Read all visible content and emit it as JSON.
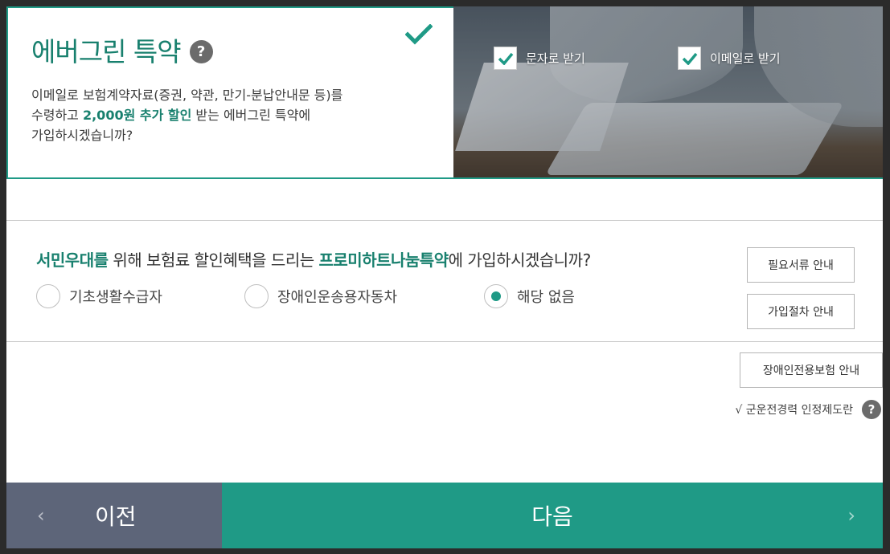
{
  "top": {
    "title": "에버그린 특약",
    "help_icon": "question-icon",
    "desc_1": "이메일로 보험계약자료(증권, 약관, 만기-분납안내문 등)를",
    "desc_2a": "수령하고 ",
    "desc_2b": "2,000원 추가 할인",
    "desc_2c": " 받는 에버그린 특약에",
    "desc_3": "가입하시겠습니까?",
    "sms_label": "문자로 받기",
    "email_label": "이메일로 받기",
    "sms_checked": true,
    "email_checked": true
  },
  "question": {
    "part1": "서민우대를",
    "part2": " 위해 보험료 할인혜택을 드리는 ",
    "part3": "프로미하트나눔특약",
    "part4": "에 가입하시겠습니까?",
    "options": [
      {
        "label": "기초생활수급자",
        "selected": false
      },
      {
        "label": "장애인운송용자동차",
        "selected": false
      },
      {
        "label": "해당 없음",
        "selected": true
      }
    ]
  },
  "buttons": {
    "docs": "필요서류 안내",
    "process": "가입절차 안내",
    "disabled_insurance": "장애인전용보험 안내"
  },
  "military": {
    "label": "√ 군운전경력 인정제도란"
  },
  "nav": {
    "prev": "이전",
    "next": "다음"
  },
  "colors": {
    "accent": "#1f9a86",
    "title": "#18806e",
    "prev_bg": "#5d6579"
  }
}
